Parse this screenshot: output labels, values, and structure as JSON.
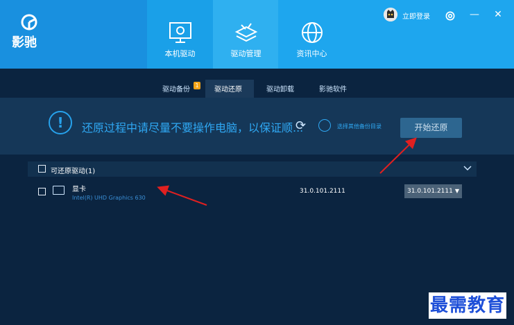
{
  "app": {
    "brand": "影驰"
  },
  "nav": [
    {
      "label": "本机驱动",
      "icon": "monitor-icon"
    },
    {
      "label": "驱动管理",
      "icon": "layers-tools-icon"
    },
    {
      "label": "资讯中心",
      "icon": "globe-icon"
    }
  ],
  "account": {
    "login_label": "立即登录"
  },
  "window": {
    "settings_icon": "gear-icon",
    "minimize": "—",
    "close": "✕"
  },
  "tabs": [
    {
      "label": "驱动备份",
      "badge": "1"
    },
    {
      "label": "驱动还原"
    },
    {
      "label": "驱动卸载"
    },
    {
      "label": "影驰软件"
    }
  ],
  "notice": {
    "text": "还原过程中请尽量不要操作电脑，以保证顺...",
    "folder_link": "选择其他备份目录",
    "start_button": "开始还原"
  },
  "group": {
    "title": "可还原驱动(1)"
  },
  "drivers": [
    {
      "name": "显卡",
      "model": "Intel(R) UHD Graphics 630",
      "version": "31.0.101.2111",
      "selected_version": "31.0.101.2111"
    }
  ],
  "watermark": "最需教育",
  "colors": {
    "accent": "#1aa0e8",
    "background": "#0b2440",
    "notice_text": "#2fa8f3",
    "arrow": "#e02020"
  }
}
